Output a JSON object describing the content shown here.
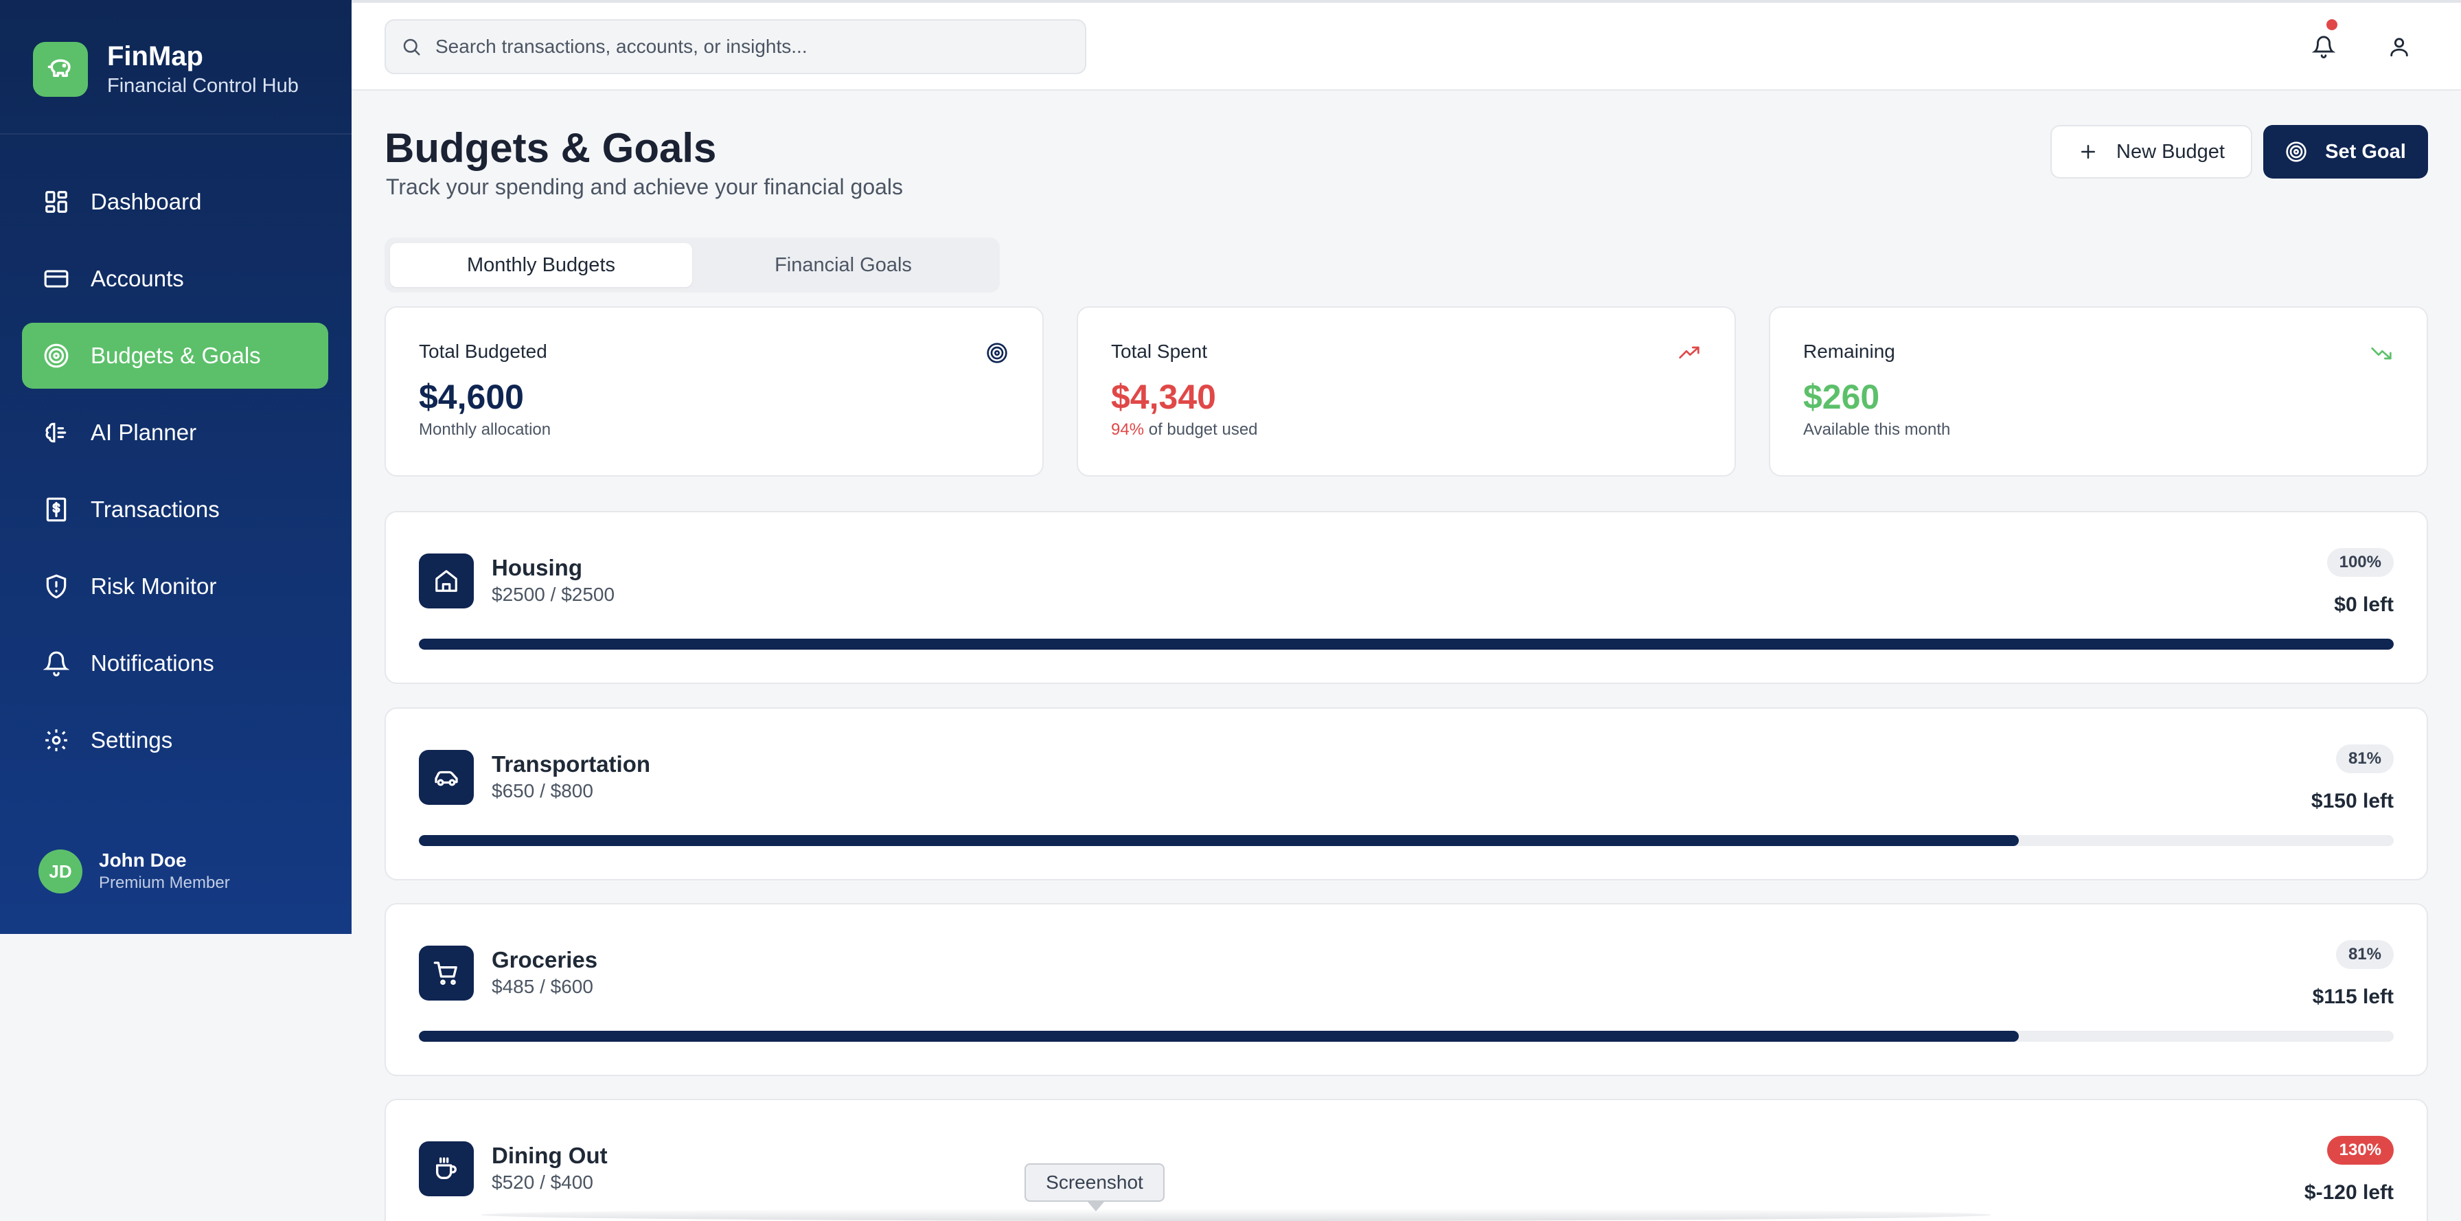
{
  "brand": {
    "title": "FinMap",
    "subtitle": "Financial Control Hub",
    "logo_icon": "piggy-bank-icon"
  },
  "nav": [
    {
      "label": "Dashboard",
      "icon": "dashboard-icon",
      "active": false
    },
    {
      "label": "Accounts",
      "icon": "credit-card-icon",
      "active": false
    },
    {
      "label": "Budgets & Goals",
      "icon": "target-icon",
      "active": true
    },
    {
      "label": "AI Planner",
      "icon": "brain-icon",
      "active": false
    },
    {
      "label": "Transactions",
      "icon": "receipt-dollar-icon",
      "active": false
    },
    {
      "label": "Risk Monitor",
      "icon": "shield-alert-icon",
      "active": false
    },
    {
      "label": "Notifications",
      "icon": "bell-icon",
      "active": false
    },
    {
      "label": "Settings",
      "icon": "gear-icon",
      "active": false
    }
  ],
  "user": {
    "initials": "JD",
    "name": "John Doe",
    "role": "Premium Member"
  },
  "search": {
    "placeholder": "Search transactions, accounts, or insights..."
  },
  "page": {
    "title": "Budgets & Goals",
    "subtitle": "Track your spending and achieve your financial goals"
  },
  "actions": {
    "new_budget": "New Budget",
    "set_goal": "Set Goal"
  },
  "tabs": [
    {
      "label": "Monthly Budgets",
      "active": true
    },
    {
      "label": "Financial Goals",
      "active": false
    }
  ],
  "stats": [
    {
      "label": "Total Budgeted",
      "value": "$4,600",
      "note": "Monthly allocation",
      "icon": "target-icon",
      "color": "#0f2552"
    },
    {
      "label": "Total Spent",
      "value": "$4,340",
      "note_highlight": "94%",
      "note": " of budget used",
      "icon": "trending-up-icon",
      "color": "#e04848"
    },
    {
      "label": "Remaining",
      "value": "$260",
      "note": "Available this month",
      "icon": "trending-down-icon",
      "color": "#5cc06a"
    }
  ],
  "budgets": [
    {
      "name": "Housing",
      "amount": "$2500 / $2500",
      "percent": "100%",
      "left": "$0 left",
      "progress": 1.0,
      "icon": "home-icon",
      "over": false
    },
    {
      "name": "Transportation",
      "amount": "$650 / $800",
      "percent": "81%",
      "left": "$150 left",
      "progress": 0.81,
      "icon": "car-icon",
      "over": false
    },
    {
      "name": "Groceries",
      "amount": "$485 / $600",
      "percent": "81%",
      "left": "$115 left",
      "progress": 0.81,
      "icon": "shopping-cart-icon",
      "over": false
    },
    {
      "name": "Dining Out",
      "amount": "$520 / $400",
      "percent": "130%",
      "left": "$-120 left",
      "progress": 1.0,
      "icon": "coffee-icon",
      "over": true
    }
  ],
  "tooltip": {
    "text": "Screenshot"
  },
  "colors": {
    "navy": "#0f2552",
    "green": "#5cc06a",
    "red": "#e04848"
  }
}
